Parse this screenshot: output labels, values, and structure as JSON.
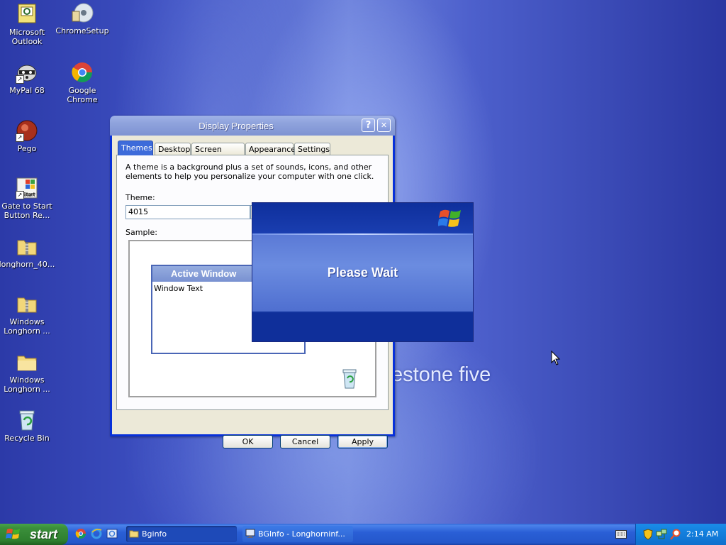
{
  "desktop": {
    "background_text": "estone five",
    "icons": [
      {
        "label": "Microsoft Outlook"
      },
      {
        "label": "ChromeSetup"
      },
      {
        "label": "MyPal 68"
      },
      {
        "label": "Google Chrome"
      },
      {
        "label": "Pego"
      },
      {
        "label": "Gate to Start Button Re..."
      },
      {
        "label": "longhorn_40..."
      },
      {
        "label": "Windows Longhorn ..."
      },
      {
        "label": "Windows Longhorn ..."
      },
      {
        "label": "Recycle Bin"
      }
    ]
  },
  "dialog": {
    "title": "Display Properties",
    "help_glyph": "?",
    "close_glyph": "✕",
    "tabs": [
      {
        "label": "Themes",
        "active": true
      },
      {
        "label": "Desktop"
      },
      {
        "label": "Screen Saver"
      },
      {
        "label": "Appearance"
      },
      {
        "label": "Settings"
      }
    ],
    "description": "A theme is a background plus a set of sounds, icons, and other elements to help you personalize your computer with one click.",
    "theme_label": "Theme:",
    "theme_value": "4015",
    "sample_label": "Sample:",
    "sample_window_title": "Active Window",
    "sample_window_text": "Window Text",
    "buttons": {
      "ok": "OK",
      "cancel": "Cancel",
      "apply": "Apply"
    }
  },
  "wait_dialog": {
    "message": "Please Wait"
  },
  "taskbar": {
    "start_label": "start",
    "items": [
      {
        "label": "Bginfo",
        "icon": "folder-icon"
      },
      {
        "label": "BGInfo - Longhorninf...",
        "icon": "monitor-icon"
      }
    ],
    "clock": "2:14 AM"
  },
  "colors": {
    "titlebar": "#8ea2dc",
    "active_tab": "#3d6bda",
    "taskbar": "#2a5fd6",
    "start_button": "#3b8f3b"
  }
}
